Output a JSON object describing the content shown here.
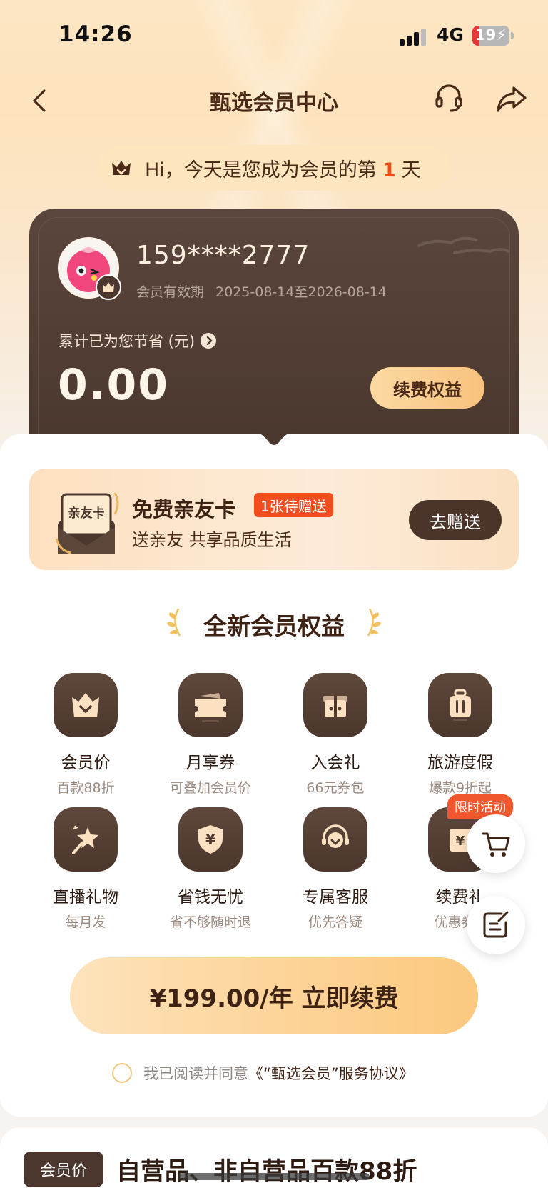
{
  "status_bar": {
    "time": "14:26",
    "network": "4G",
    "battery": "19",
    "battery_level": 0.19
  },
  "nav": {
    "title": "甄选会员中心"
  },
  "greeting": {
    "prefix": "Hi，今天是您成为会员的第",
    "day": "1",
    "suffix": "天"
  },
  "card": {
    "phone": "159****2777",
    "validity_label": "会员有效期",
    "validity_dates": "2025-08-14至2026-08-14",
    "saved_label": "累计已为您节省 (元)",
    "saved_amount": "0.00",
    "renew_button": "续费权益"
  },
  "friend_card": {
    "envelope_label": "亲友卡",
    "title": "免费亲友卡",
    "badge": "1张待赠送",
    "subtitle": "送亲友 共享品质生活",
    "button": "去赠送"
  },
  "benefits": {
    "title": "全新会员权益",
    "items": [
      {
        "name": "会员价",
        "desc": "百款88折",
        "icon": "crown-cup-icon"
      },
      {
        "name": "月享券",
        "desc": "可叠加会员价",
        "icon": "coupon-icon"
      },
      {
        "name": "入会礼",
        "desc": "66元券包",
        "icon": "gift-icon"
      },
      {
        "name": "旅游度假",
        "desc": "爆款9折起",
        "icon": "luggage-icon"
      },
      {
        "name": "直播礼物",
        "desc": "每月发",
        "icon": "magic-wand-icon"
      },
      {
        "name": "省钱无忧",
        "desc": "省不够随时退",
        "icon": "yuan-shield-icon"
      },
      {
        "name": "专属客服",
        "desc": "优先答疑",
        "icon": "support-agent-icon"
      },
      {
        "name": "续费礼",
        "desc": "优惠券+",
        "icon": "renew-gift-icon"
      }
    ],
    "limited_tag": "限时活动"
  },
  "renew": {
    "button": "¥199.00/年 立即续费",
    "agree_text": "我已阅读并同意",
    "agree_link": "《“甄选会员”服务协议》"
  },
  "bottom": {
    "tag": "会员价",
    "title": "自营品、非自营品百款88折"
  }
}
